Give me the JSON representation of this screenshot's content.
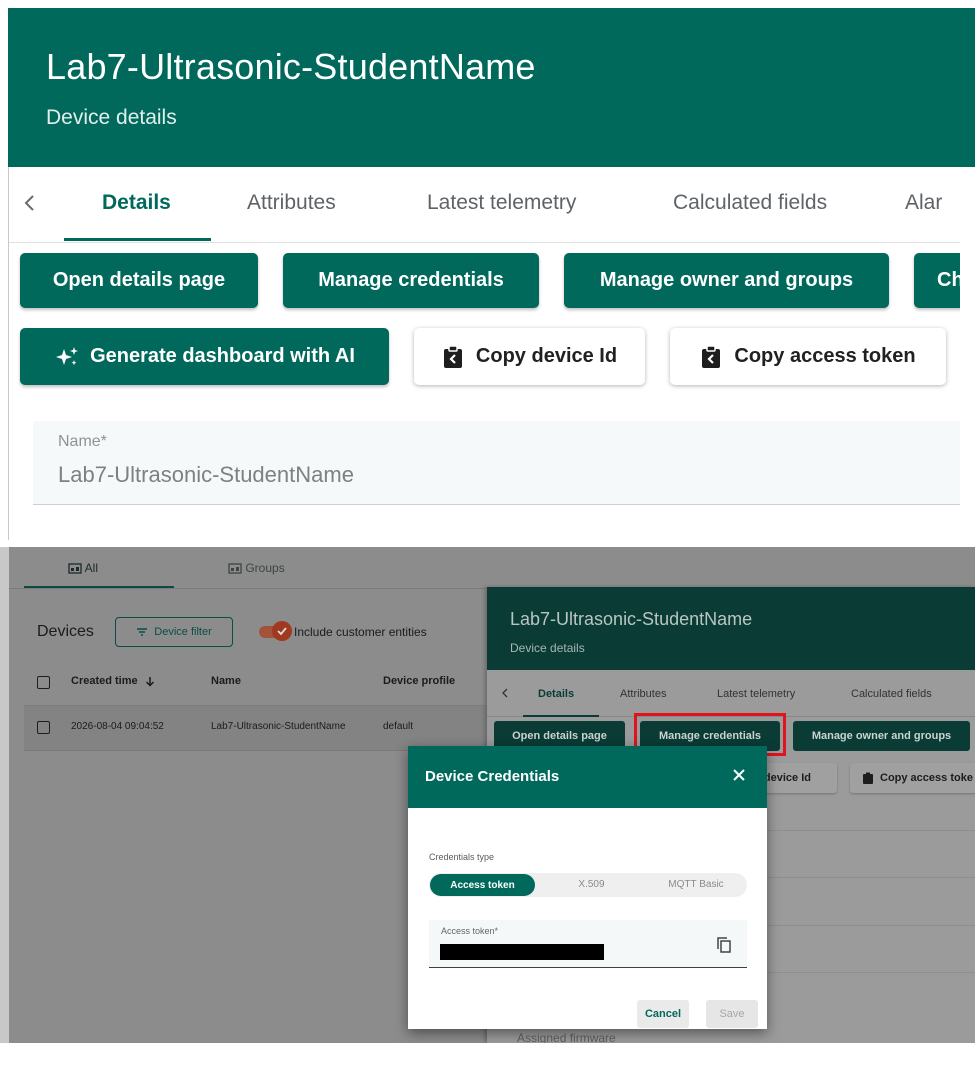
{
  "top": {
    "device_title": "Lab7-Ultrasonic-StudentName",
    "subtitle": "Device details",
    "tabs": [
      "Details",
      "Attributes",
      "Latest telemetry",
      "Calculated fields",
      "Alar"
    ],
    "active_tab": "Details",
    "actions": {
      "open_details": "Open details page",
      "manage_credentials": "Manage credentials",
      "manage_owner": "Manage owner and groups",
      "cut_button": "Ch",
      "generate_ai": "Generate dashboard with AI",
      "copy_device_id": "Copy device Id",
      "copy_access_token": "Copy access token"
    },
    "name_field": {
      "label": "Name*",
      "value": "Lab7-Ultrasonic-StudentName"
    },
    "colors": {
      "primary": "#00695c"
    }
  },
  "bottom": {
    "tabs": {
      "all": "All",
      "groups": "Groups"
    },
    "devices": {
      "title": "Devices",
      "filter_button": "Device filter",
      "include_customer": "Include customer entities",
      "columns": [
        "Created time",
        "Name",
        "Device profile"
      ],
      "rows": [
        {
          "created": "2026-08-04 09:04:52",
          "name": "Lab7-Ultrasonic-StudentName",
          "profile": "default"
        }
      ]
    },
    "details": {
      "title": "Lab7-Ultrasonic-StudentName",
      "subtitle": "Device details",
      "tabs": [
        "Details",
        "Attributes",
        "Latest telemetry",
        "Calculated fields"
      ],
      "actions": {
        "open_details": "Open details page",
        "manage_credentials": "Manage credentials",
        "manage_owner": "Manage owner and groups",
        "copy_device_id": "device Id",
        "copy_access_token": "Copy access toke"
      },
      "assigned_firmware": "Assigned firmware"
    },
    "dialog": {
      "title": "Device Credentials",
      "credentials_type_label": "Credentials type",
      "options": [
        "Access token",
        "X.509",
        "MQTT Basic"
      ],
      "selected_option": "Access token",
      "access_token_label": "Access token*",
      "cancel": "Cancel",
      "save": "Save"
    },
    "highlight_color": "#e0141d"
  }
}
